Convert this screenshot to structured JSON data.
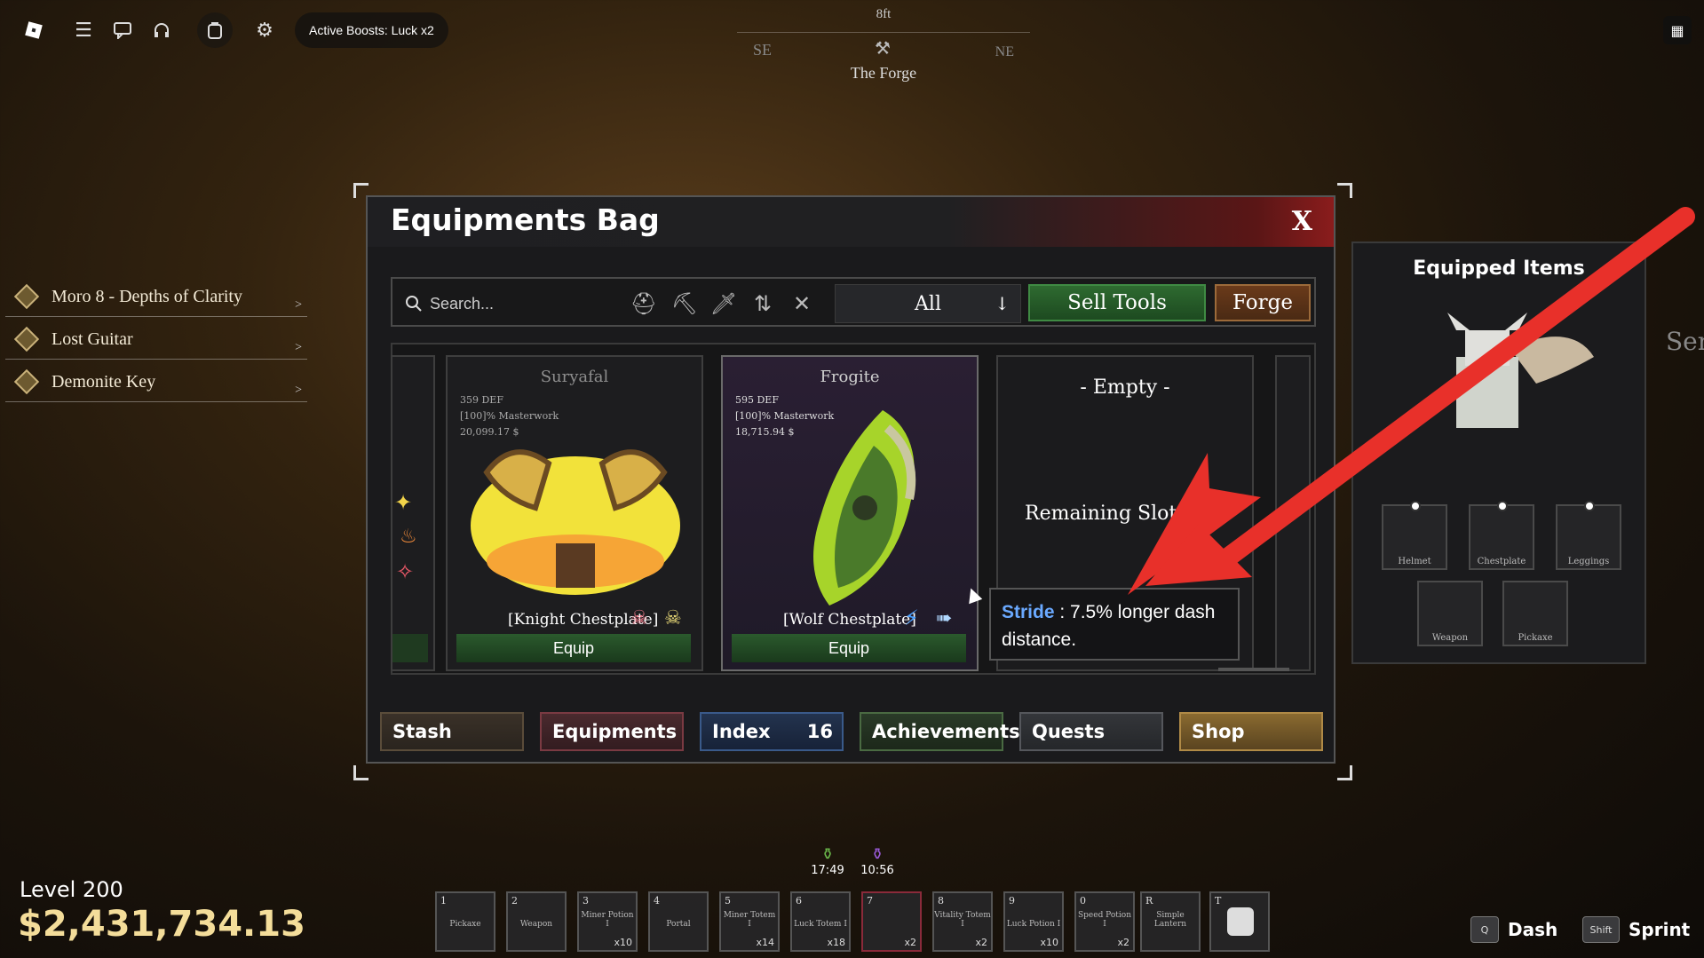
{
  "topbar": {
    "boost_text": "Active Boosts: Luck x2",
    "icons": [
      "roblox-logo-icon",
      "menu-icon",
      "chat-icon",
      "headset-icon",
      "backpack-icon",
      "gear-icon",
      "calendar-icon"
    ]
  },
  "compass": {
    "distance": "8ft",
    "left": "SE",
    "right": "NE",
    "target": "The Forge"
  },
  "quests": [
    {
      "label": "Moro 8 - Depths of Clarity"
    },
    {
      "label": "Lost Guitar"
    },
    {
      "label": "Demonite Key"
    }
  ],
  "window": {
    "title": "Equipments Bag",
    "close": "X",
    "search_placeholder": "Search...",
    "filter_value": "All",
    "sell_label": "Sell Tools",
    "forge_label": "Forge",
    "cards": [
      {
        "name": "Suryafal",
        "def": "359 DEF",
        "masterwork": "[100]% Masterwork",
        "price": "20,099.17 $",
        "label": "[Knight Chestplate]",
        "equip": "Equip"
      },
      {
        "name": "Frogite",
        "def": "595 DEF",
        "masterwork": "[100]% Masterwork",
        "price": "18,715.94 $",
        "label": "[Wolf Chestplate]",
        "equip": "Equip"
      }
    ],
    "empty": {
      "title": "- Empty -",
      "sub": "Remaining Slots: "
    },
    "tabs": [
      {
        "label": "Stash"
      },
      {
        "label": "Equipments"
      },
      {
        "label": "Index",
        "badge": "16"
      },
      {
        "label": "Achievements"
      },
      {
        "label": "Quests"
      },
      {
        "label": "Shop"
      }
    ]
  },
  "tooltip": {
    "key": "Stride",
    "text": " : 7.5% longer dash distance."
  },
  "equipped": {
    "title": "Equipped Items",
    "slots": [
      "Helmet",
      "Chestplate",
      "Leggings",
      "Weapon",
      "Pickaxe"
    ]
  },
  "player": {
    "level": "Level 200",
    "money": "$2,431,734.13"
  },
  "timers": [
    "17:49",
    "10:56"
  ],
  "hotbar": [
    {
      "key": "1",
      "name": "Pickaxe",
      "qty": ""
    },
    {
      "key": "2",
      "name": "Weapon",
      "qty": ""
    },
    {
      "key": "3",
      "name": "Miner Potion I",
      "qty": "x10"
    },
    {
      "key": "4",
      "name": "Portal",
      "qty": ""
    },
    {
      "key": "5",
      "name": "Miner Totem I",
      "qty": "x14"
    },
    {
      "key": "6",
      "name": "Luck Totem I",
      "qty": "x18"
    },
    {
      "key": "7",
      "name": "",
      "qty": "x2"
    },
    {
      "key": "8",
      "name": "Vitality Totem I",
      "qty": "x2"
    },
    {
      "key": "9",
      "name": "Luck Potion I",
      "qty": "x10"
    },
    {
      "key": "0",
      "name": "Speed Potion I",
      "qty": "x2"
    },
    {
      "key": "R",
      "name": "Simple Lantern",
      "qty": ""
    },
    {
      "key": "T",
      "name": "",
      "qty": ""
    }
  ],
  "controls": [
    {
      "key": "Q",
      "action": "Dash"
    },
    {
      "key": "Shift",
      "action": "Sprint"
    }
  ],
  "side_text": "Ser",
  "colors": {
    "accent_green": "#2e6a30",
    "accent_red": "#c0392b",
    "money_gold": "#f4dd9a"
  }
}
